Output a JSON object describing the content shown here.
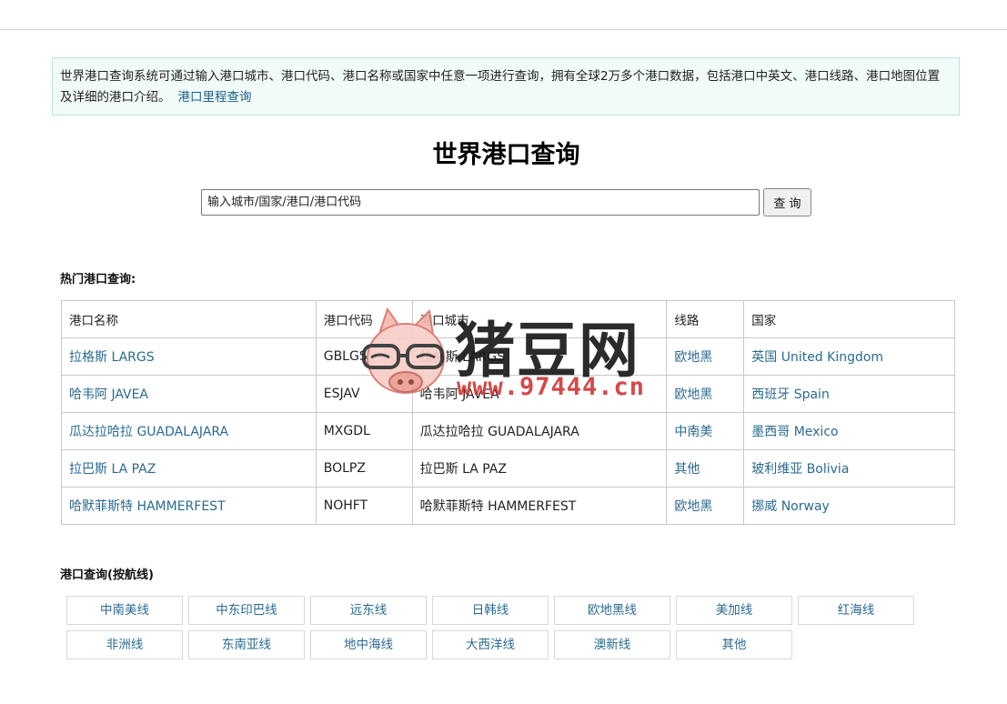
{
  "notice": {
    "text": "世界港口查询系统可通过输入港口城市、港口代码、港口名称或国家中任意一项进行查询，拥有全球2万多个港口数据，包括港口中英文、港口线路、港口地图位置及详细的港口介绍。",
    "link": "港口里程查询"
  },
  "page_title": "世界港口查询",
  "search": {
    "placeholder": "输入城市/国家/港口/港口代码",
    "button": "查 询"
  },
  "hot_title": "热门港口查询:",
  "table": {
    "headers": [
      "港口名称",
      "港口代码",
      "港口城市",
      "线路",
      "国家"
    ],
    "rows": [
      [
        "拉格斯 LARGS",
        "GBLGS",
        "拉格斯 LARGS",
        "欧地黑",
        "英国 United Kingdom"
      ],
      [
        "哈韦阿 JAVEA",
        "ESJAV",
        "哈韦阿 JAVEA",
        "欧地黑",
        "西班牙 Spain"
      ],
      [
        "瓜达拉哈拉 GUADALAJARA",
        "MXGDL",
        "瓜达拉哈拉 GUADALAJARA",
        "中南美",
        "墨西哥 Mexico"
      ],
      [
        "拉巴斯 LA PAZ",
        "BOLPZ",
        "拉巴斯 LA PAZ",
        "其他",
        "玻利维亚 Bolivia"
      ],
      [
        "哈默菲斯特 HAMMERFEST",
        "NOHFT",
        "哈默菲斯特 HAMMERFEST",
        "欧地黑",
        "挪威 Norway"
      ]
    ]
  },
  "route_title": "港口查询(按航线)",
  "routes": [
    "中南美线",
    "中东印巴线",
    "远东线",
    "日韩线",
    "欧地黑线",
    "美加线",
    "红海线",
    "非洲线",
    "东南亚线",
    "地中海线",
    "大西洋线",
    "澳新线",
    "其他"
  ],
  "watermark": {
    "text": "猪豆网",
    "url": "www.97444.cn"
  },
  "colors": {
    "link": "#2a6a90",
    "notice_bg": "#f1fbf8",
    "notice_border": "#b8e6dc"
  }
}
